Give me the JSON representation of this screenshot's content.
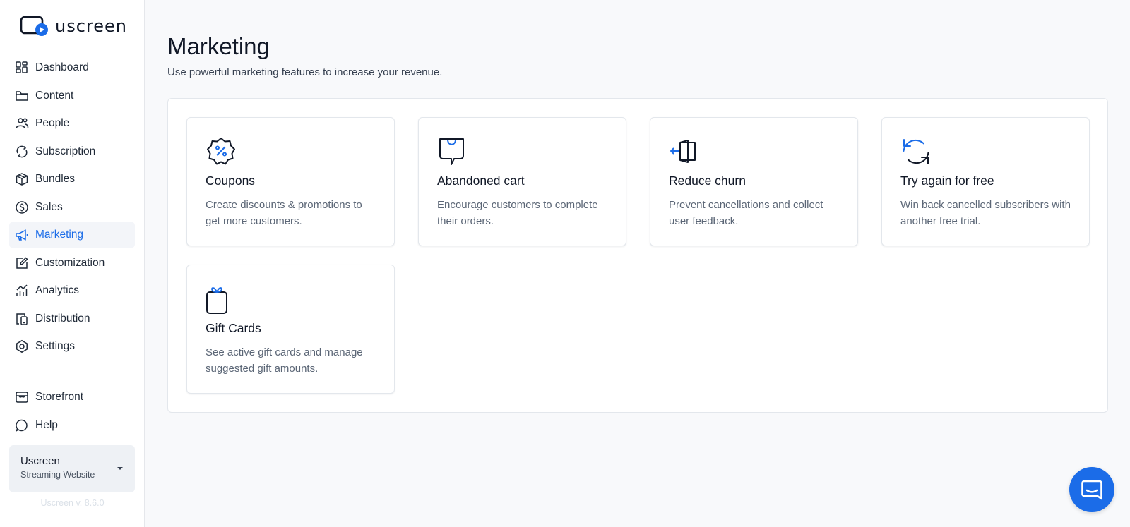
{
  "brand": {
    "name": "uscreen",
    "accent": "#1b6ce8"
  },
  "sidebar": {
    "items": [
      {
        "label": "Dashboard",
        "icon": "grid-icon"
      },
      {
        "label": "Content",
        "icon": "folder-icon"
      },
      {
        "label": "People",
        "icon": "people-icon"
      },
      {
        "label": "Subscription",
        "icon": "refresh-icon"
      },
      {
        "label": "Bundles",
        "icon": "box-icon"
      },
      {
        "label": "Sales",
        "icon": "dollar-icon"
      },
      {
        "label": "Marketing",
        "icon": "megaphone-icon",
        "active": true
      },
      {
        "label": "Customization",
        "icon": "edit-icon"
      },
      {
        "label": "Analytics",
        "icon": "chart-icon"
      },
      {
        "label": "Distribution",
        "icon": "devices-icon"
      },
      {
        "label": "Settings",
        "icon": "hexagon-settings-icon"
      }
    ],
    "bottom_items": [
      {
        "label": "Storefront",
        "icon": "storefront-icon"
      },
      {
        "label": "Help",
        "icon": "chat-bubble-icon"
      }
    ],
    "account": {
      "name": "Uscreen",
      "subtitle": "Streaming Website"
    },
    "version": "Uscreen v. 8.6.0"
  },
  "main": {
    "title": "Marketing",
    "subtitle": "Use powerful marketing features to increase your revenue.",
    "cards": [
      {
        "title": "Coupons",
        "description": "Create discounts & promotions to get more customers.",
        "icon": "coupon-badge-icon"
      },
      {
        "title": "Abandoned cart",
        "description": "Encourage customers to complete their orders.",
        "icon": "shopping-bag-icon"
      },
      {
        "title": "Reduce churn",
        "description": "Prevent cancellations and collect user feedback.",
        "icon": "door-exit-icon"
      },
      {
        "title": "Try again for free",
        "description": "Win back cancelled subscribers with another free trial.",
        "icon": "retry-arrows-icon"
      },
      {
        "title": "Gift Cards",
        "description": "See active gift cards and manage suggested gift amounts.",
        "icon": "gift-icon"
      }
    ]
  },
  "chat_widget": {
    "icon": "chat-widget-icon"
  }
}
